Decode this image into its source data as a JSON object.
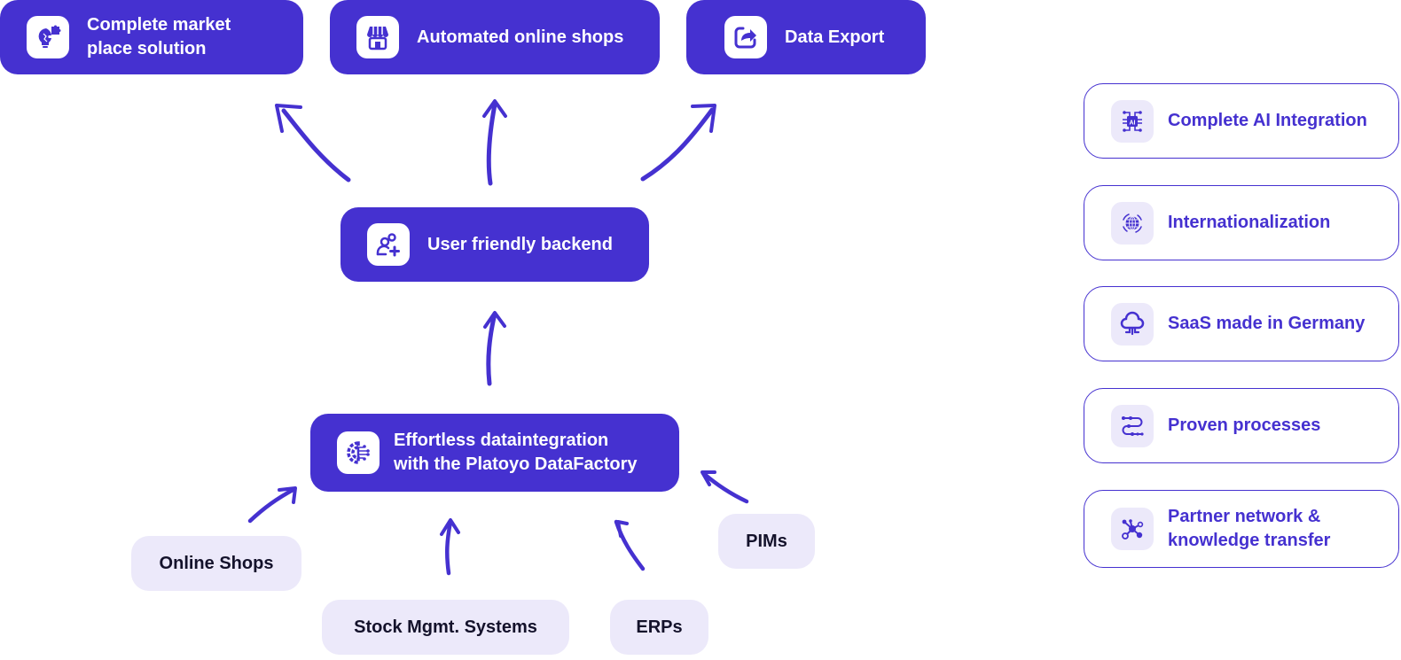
{
  "theme": {
    "primary": "#4531d0",
    "source_bg": "#ece9fa",
    "source_text": "#14122b",
    "white": "#ffffff"
  },
  "outputs": [
    {
      "label": "Complete market\nplace solution",
      "icon": "lightbulb-puzzle-icon"
    },
    {
      "label": "Automated online shops",
      "icon": "storefront-icon"
    },
    {
      "label": "Data Export",
      "icon": "share-export-icon"
    }
  ],
  "backend": {
    "label": "User friendly backend",
    "icon": "add-user-icon"
  },
  "datafactory": {
    "label": "Effortless dataintegration\nwith the Platoyo DataFactory",
    "icon": "gear-network-icon"
  },
  "sources": [
    {
      "label": "Online Shops"
    },
    {
      "label": "Stock Mgmt. Systems"
    },
    {
      "label": "ERPs"
    },
    {
      "label": "PIMs"
    }
  ],
  "features": [
    {
      "label": "Complete AI Integration",
      "icon": "ai-chip-icon"
    },
    {
      "label": "Internationalization",
      "icon": "globe-icon"
    },
    {
      "label": "SaaS made in Germany",
      "icon": "cloud-server-icon"
    },
    {
      "label": "Proven processes",
      "icon": "process-flow-icon"
    },
    {
      "label": "Partner network &\nknowledge transfer",
      "icon": "network-nodes-icon"
    }
  ]
}
